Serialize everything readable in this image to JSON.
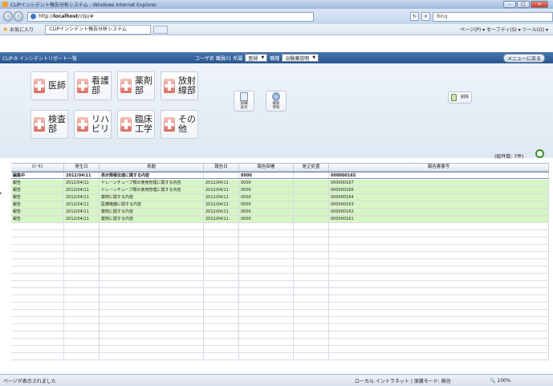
{
  "browser": {
    "window_title": "CLIPインシデント報告分析システム - Windows Internet Explorer",
    "address_prefix": "http://",
    "address_host": "localhost",
    "address_path": "/clip/#",
    "search_placeholder": "Bing",
    "favorites_label": "お気に入り",
    "tab_label": "CLIPインシデント報告分析システム",
    "toolbar_text": "ページ(P) ▾  セーフティ(S) ▾  ツール(O) ▾",
    "status_text": "ページが表示されました",
    "zone_text": "ローカル イントラネット | 保護モード: 無効",
    "zoom_text": "100%"
  },
  "app": {
    "title": "CLIP-R インシデントリポート一覧",
    "user_label": "ユーザ名",
    "user_name": "職員01",
    "dept_label": "所属",
    "dept_value": "医師",
    "job_label": "職種",
    "job_value": "治験薬説明",
    "menu_button": "メニューに戻る",
    "record_count": "(総件数: 7件)"
  },
  "categories": [
    {
      "label": "医師"
    },
    {
      "label": "看護\n部"
    },
    {
      "label": "薬剤\n部"
    },
    {
      "label": "放射\n線部"
    },
    {
      "label": "検査\n部"
    },
    {
      "label": "リハ\nビリ"
    },
    {
      "label": "臨床\n工学"
    },
    {
      "label": "その\n他"
    }
  ],
  "doc_buttons": [
    {
      "label": "詳細\n表示"
    },
    {
      "label": "検索\n参照"
    }
  ],
  "delete_button": "削除",
  "table": {
    "columns": [
      "ｽﾃｰﾀｽ",
      "発生日",
      "表題",
      "報告日",
      "報告部署",
      "是正処置",
      "報告書番号"
    ],
    "rows": [
      {
        "status": "編集中",
        "date": "2012/04/11",
        "title": "表示情報伝達に関する内容",
        "report_date": "",
        "dept": "0000",
        "fix": "",
        "number": "000000165"
      },
      {
        "status": "報告",
        "date": "2012/04/11",
        "title": "ドレーンチューブ類の使用管理に関する内容",
        "report_date": "2012/04/11",
        "dept": "0000",
        "fix": "",
        "number": "000000167"
      },
      {
        "status": "報告",
        "date": "2012/04/11",
        "title": "ドレーンチューブ類の使用管理に関する内容",
        "report_date": "2012/04/11",
        "dept": "0000",
        "fix": "",
        "number": "000000166"
      },
      {
        "status": "報告",
        "date": "2012/04/11",
        "title": "薬剤に関する内容",
        "report_date": "2012/04/11",
        "dept": "0000",
        "fix": "",
        "number": "000000164"
      },
      {
        "status": "報告",
        "date": "2012/04/11",
        "title": "医療機器に関する内容",
        "report_date": "2012/04/11",
        "dept": "0000",
        "fix": "",
        "number": "000000163"
      },
      {
        "status": "報告",
        "date": "2012/04/11",
        "title": "薬剤に関する内容",
        "report_date": "2012/04/11",
        "dept": "0000",
        "fix": "",
        "number": "000000162"
      },
      {
        "status": "報告",
        "date": "2012/04/11",
        "title": "薬剤に関する内容",
        "report_date": "2012/04/11",
        "dept": "0000",
        "fix": "",
        "number": "000000161"
      }
    ]
  },
  "colors": {
    "header_blue": "#28548f",
    "row_green": "#d7f5c4"
  }
}
